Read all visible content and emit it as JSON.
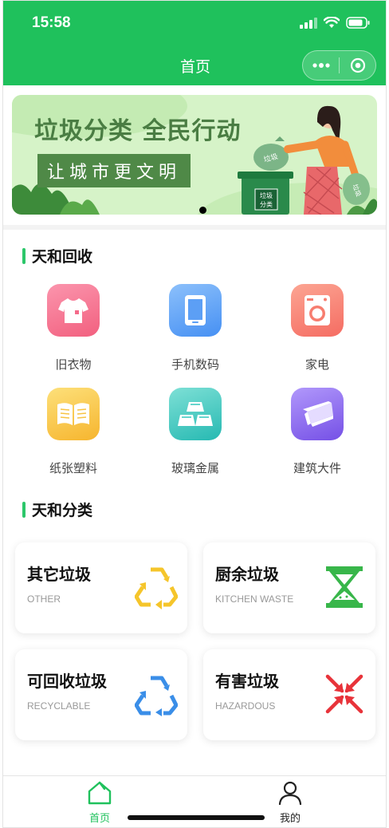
{
  "status": {
    "time": "15:58"
  },
  "header": {
    "title": "首页"
  },
  "banner": {
    "title": "垃圾分类 全民行动",
    "subtitle": "让城市更文明",
    "bin_label": "垃圾分类",
    "bag_labels": [
      "垃圾",
      "垃圾"
    ]
  },
  "recycle": {
    "heading": "天和回收",
    "items": [
      {
        "label": "旧衣物",
        "icon": "tshirt-icon",
        "color": "#f46b8a"
      },
      {
        "label": "手机数码",
        "icon": "phone-icon",
        "color": "#4f9bf7"
      },
      {
        "label": "家电",
        "icon": "washing-machine-icon",
        "color": "#f77d6f"
      },
      {
        "label": "纸张塑料",
        "icon": "book-icon",
        "color": "#f7c343"
      },
      {
        "label": "玻璃金属",
        "icon": "metal-bars-icon",
        "color": "#35c7be"
      },
      {
        "label": "建筑大件",
        "icon": "steel-beam-icon",
        "color": "#8a66ee"
      }
    ]
  },
  "classify": {
    "heading": "天和分类",
    "cards": [
      {
        "name": "其它垃圾",
        "en": "OTHER",
        "icon": "recycle-triangle-yellow-icon",
        "color": "#f5c52b"
      },
      {
        "name": "厨余垃圾",
        "en": "KITCHEN WASTE",
        "icon": "hourglass-icon",
        "color": "#38b64a"
      },
      {
        "name": "可回收垃圾",
        "en": "RECYCLABLE",
        "icon": "recycle-triangle-blue-icon",
        "color": "#3a8ee8"
      },
      {
        "name": "有害垃圾",
        "en": "HAZARDOUS",
        "icon": "hazard-arrows-icon",
        "color": "#e8333a"
      }
    ]
  },
  "tabbar": {
    "home": {
      "label": "首页",
      "color": "#1fc15c"
    },
    "mine": {
      "label": "我的",
      "color": "#222222"
    }
  }
}
